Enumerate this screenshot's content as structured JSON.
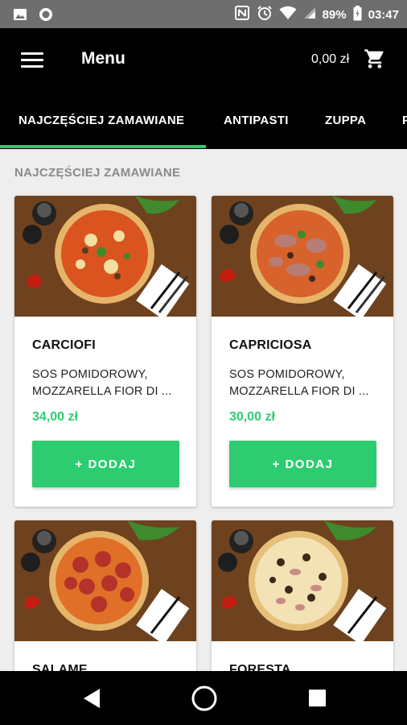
{
  "status_bar": {
    "battery": "89%",
    "time": "03:47"
  },
  "app_bar": {
    "title": "Menu",
    "cart_total": "0,00 zł"
  },
  "tabs": [
    {
      "label": "NAJCZĘŚCIEJ ZAMAWIANE",
      "selected": true
    },
    {
      "label": "ANTIPASTI",
      "selected": false
    },
    {
      "label": "ZUPPA",
      "selected": false
    },
    {
      "label": "P",
      "selected": false
    }
  ],
  "section": {
    "title": "NAJCZĘŚCIEJ ZAMAWIANE"
  },
  "products": [
    {
      "name": "CARCIOFI",
      "desc_line1": "SOS POMIDOROWY,",
      "desc_line2": "MOZZARELLA FIOR DI ...",
      "price": "34,00 zł",
      "button": "+ DODAJ"
    },
    {
      "name": "CAPRICIOSA",
      "desc_line1": "SOS POMIDOROWY,",
      "desc_line2": "MOZZARELLA FIOR DI ...",
      "price": "30,00 zł",
      "button": "+ DODAJ"
    },
    {
      "name": "SALAME",
      "desc_line1": "",
      "desc_line2": "",
      "price": "",
      "button": ""
    },
    {
      "name": "FORESTA",
      "desc_line1": "",
      "desc_line2": "",
      "price": "",
      "button": ""
    }
  ],
  "colors": {
    "accent": "#2ecc71",
    "status_bar": "#6e6e6e",
    "app_bar": "#000000",
    "background": "#eeeeee"
  }
}
